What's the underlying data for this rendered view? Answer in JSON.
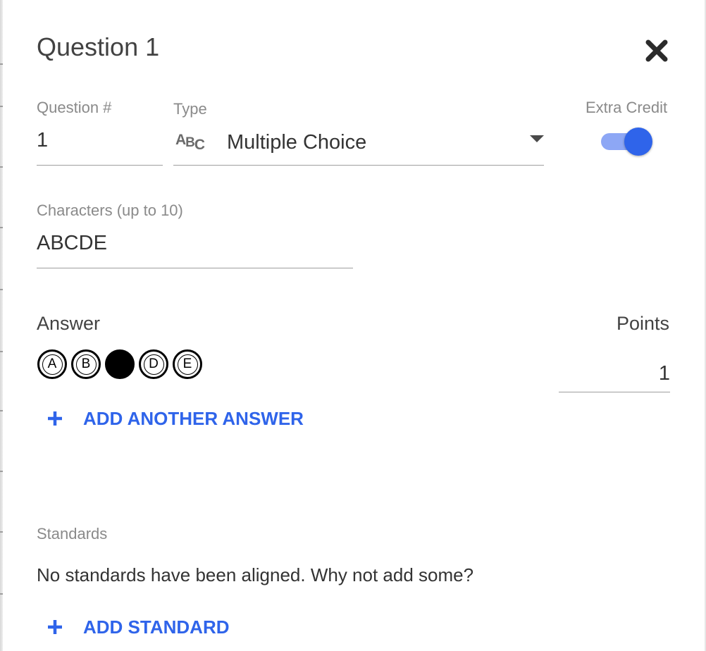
{
  "dialog": {
    "title": "Question 1",
    "close_icon": "close-icon"
  },
  "question_number": {
    "label": "Question #",
    "value": "1"
  },
  "type": {
    "label": "Type",
    "icon": "abc-icon",
    "icon_text": {
      "a": "A",
      "b": "B",
      "c": "C"
    },
    "selected": "Multiple Choice"
  },
  "extra_credit": {
    "label": "Extra Credit",
    "enabled": true
  },
  "characters": {
    "label": "Characters (up to 10)",
    "value": "ABCDE"
  },
  "answer": {
    "label": "Answer",
    "choices": [
      {
        "letter": "A",
        "selected": false
      },
      {
        "letter": "B",
        "selected": false
      },
      {
        "letter": "C",
        "selected": true
      },
      {
        "letter": "D",
        "selected": false
      },
      {
        "letter": "E",
        "selected": false
      }
    ],
    "add_label": "ADD ANOTHER ANSWER"
  },
  "points": {
    "label": "Points",
    "value": "1"
  },
  "standards": {
    "label": "Standards",
    "empty_text": "No standards have been aligned. Why not add some?",
    "add_label": "ADD STANDARD"
  },
  "colors": {
    "accent": "#2f64ea",
    "toggle_track": "#8da7f5",
    "text": "#424242",
    "muted": "#8a8a8a"
  }
}
